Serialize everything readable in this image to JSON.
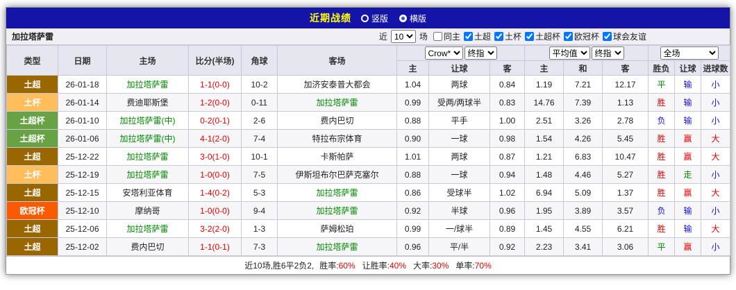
{
  "titlebar": {
    "title": "近期战绩",
    "layout_options": [
      {
        "label": "竖版",
        "selected": false
      },
      {
        "label": "横版",
        "selected": true
      }
    ]
  },
  "filterbar": {
    "team": "加拉塔萨雷",
    "near_label": "近",
    "match_count": "10",
    "games_label": "场",
    "checkboxes": [
      {
        "label": "同主",
        "checked": false
      },
      {
        "label": "土超",
        "checked": true
      },
      {
        "label": "土杯",
        "checked": true
      },
      {
        "label": "土超杯",
        "checked": true
      },
      {
        "label": "欧冠杯",
        "checked": true
      },
      {
        "label": "球会友谊",
        "checked": true
      }
    ]
  },
  "table": {
    "headers": {
      "type": "类型",
      "date": "日期",
      "home": "主场",
      "score": "比分(半场)",
      "corner": "角球",
      "away": "客场",
      "odds_source_select": "Crow*",
      "odds_final_select": "终指",
      "avg_select": "平均值",
      "avg_final_select": "终指",
      "scope_select": "全场",
      "sub": [
        "主",
        "让球",
        "客",
        "主",
        "和",
        "客",
        "胜负",
        "让球",
        "进球数"
      ]
    },
    "rows": [
      {
        "league": "土超",
        "date": "26-01-18",
        "home": "加拉塔萨雷",
        "home_hl": true,
        "score": "1-1(0-0)",
        "corner": "10-2",
        "away": "加济安泰普大都会",
        "away_hl": false,
        "odds": [
          "1.04",
          "两球",
          "0.84"
        ],
        "avg": [
          "1.19",
          "7.21",
          "12.17"
        ],
        "results": [
          "平",
          "输",
          "小"
        ]
      },
      {
        "league": "土杯",
        "date": "26-01-14",
        "home": "费迪耶斯堡",
        "home_hl": false,
        "score": "1-2(0-0)",
        "corner": "0-11",
        "away": "加拉塔萨雷",
        "away_hl": true,
        "odds": [
          "0.99",
          "受两/两球半",
          "0.83"
        ],
        "avg": [
          "14.76",
          "7.39",
          "1.13"
        ],
        "results": [
          "胜",
          "输",
          "小"
        ]
      },
      {
        "league": "土超杯",
        "date": "26-01-10",
        "home": "加拉塔萨雷(中)",
        "home_hl": true,
        "score": "0-2(0-1)",
        "corner": "2-6",
        "away": "费内巴切",
        "away_hl": false,
        "odds": [
          "0.88",
          "平手",
          "1.00"
        ],
        "avg": [
          "2.51",
          "3.26",
          "2.78"
        ],
        "results": [
          "负",
          "输",
          "小"
        ]
      },
      {
        "league": "土超杯",
        "date": "26-01-06",
        "home": "加拉塔萨雷(中)",
        "home_hl": true,
        "score": "4-1(2-0)",
        "corner": "7-4",
        "away": "特拉布宗体育",
        "away_hl": false,
        "odds": [
          "0.90",
          "一球",
          "0.98"
        ],
        "avg": [
          "1.54",
          "4.26",
          "5.45"
        ],
        "results": [
          "胜",
          "赢",
          "大"
        ]
      },
      {
        "league": "土超",
        "date": "25-12-22",
        "home": "加拉塔萨雷",
        "home_hl": true,
        "score": "3-0(1-0)",
        "corner": "10-1",
        "away": "卡斯帕萨",
        "away_hl": false,
        "odds": [
          "1.01",
          "两球",
          "0.87"
        ],
        "avg": [
          "1.21",
          "6.83",
          "10.47"
        ],
        "results": [
          "胜",
          "赢",
          "大"
        ]
      },
      {
        "league": "土杯",
        "date": "25-12-19",
        "home": "加拉塔萨雷",
        "home_hl": true,
        "score": "1-0(0-0)",
        "corner": "7-5",
        "away": "伊斯坦布尔巴萨克塞尔",
        "away_hl": false,
        "odds": [
          "0.88",
          "一球",
          "0.94"
        ],
        "avg": [
          "1.48",
          "4.46",
          "5.27"
        ],
        "results": [
          "胜",
          "走",
          "小"
        ]
      },
      {
        "league": "土超",
        "date": "25-12-15",
        "home": "安塔利亚体育",
        "home_hl": false,
        "score": "1-4(0-2)",
        "corner": "5-3",
        "away": "加拉塔萨雷",
        "away_hl": true,
        "odds": [
          "0.86",
          "受球半",
          "1.02"
        ],
        "avg": [
          "6.94",
          "5.09",
          "1.37"
        ],
        "results": [
          "胜",
          "赢",
          "大"
        ]
      },
      {
        "league": "欧冠杯",
        "date": "25-12-10",
        "home": "摩纳哥",
        "home_hl": false,
        "score": "1-0(0-0)",
        "corner": "9-4",
        "away": "加拉塔萨雷",
        "away_hl": true,
        "odds": [
          "0.92",
          "半球",
          "0.96"
        ],
        "avg": [
          "1.95",
          "3.89",
          "3.57"
        ],
        "results": [
          "负",
          "输",
          "小"
        ]
      },
      {
        "league": "土超",
        "date": "25-12-06",
        "home": "加拉塔萨雷",
        "home_hl": true,
        "score": "3-2(2-0)",
        "corner": "1-3",
        "away": "萨姆松珀",
        "away_hl": false,
        "odds": [
          "0.99",
          "一/球半",
          "0.89"
        ],
        "avg": [
          "1.45",
          "4.55",
          "6.21"
        ],
        "results": [
          "胜",
          "输",
          "大"
        ]
      },
      {
        "league": "土超",
        "date": "25-12-02",
        "home": "费内巴切",
        "home_hl": false,
        "score": "1-1(0-1)",
        "corner": "7-3",
        "away": "加拉塔萨雷",
        "away_hl": true,
        "odds": [
          "0.96",
          "平/半",
          "0.92"
        ],
        "avg": [
          "2.23",
          "3.41",
          "3.06"
        ],
        "results": [
          "平",
          "赢",
          "小"
        ]
      }
    ]
  },
  "league_colors": {
    "土超": "#996600",
    "土杯": "#FFBE5C",
    "土超杯": "#67A345",
    "欧冠杯": "#FA5A00"
  },
  "result_colors": {
    "胜": "red",
    "平": "green",
    "负": "blue",
    "赢": "red",
    "输": "blue",
    "走": "green",
    "大": "red",
    "小": "blue"
  },
  "footer": {
    "summary": "近10场,胜6平2负2,",
    "stats": [
      {
        "label": "胜率:",
        "value": "60%"
      },
      {
        "label": "让胜率:",
        "value": "40%"
      },
      {
        "label": "大率:",
        "value": "30%"
      },
      {
        "label": "单率:",
        "value": "70%"
      }
    ]
  }
}
